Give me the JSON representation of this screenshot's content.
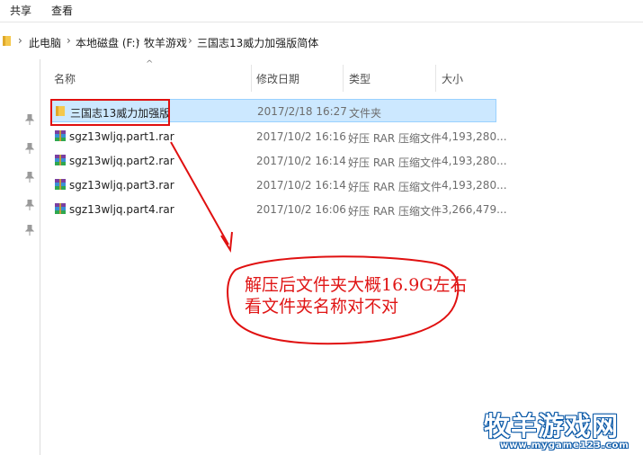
{
  "ribbon": {
    "tabs": [
      "共享",
      "查看"
    ]
  },
  "address": {
    "crumbs": [
      "此电脑",
      "本地磁盘 (F:)",
      "牧羊游戏",
      "三国志13威力加强版简体"
    ]
  },
  "columns": {
    "name": "名称",
    "date": "修改日期",
    "type": "类型",
    "size": "大小"
  },
  "files": [
    {
      "name": "三国志13威力加强版",
      "date": "2017/2/18 16:27",
      "type": "文件夹",
      "size": "",
      "icon": "folder-icon",
      "selected": true
    },
    {
      "name": "sgz13wljq.part1.rar",
      "date": "2017/10/2 16:16",
      "type": "好压 RAR 压缩文件",
      "size": "4,193,280...",
      "icon": "rar-archive-icon"
    },
    {
      "name": "sgz13wljq.part2.rar",
      "date": "2017/10/2 16:14",
      "type": "好压 RAR 压缩文件",
      "size": "4,193,280...",
      "icon": "rar-archive-icon"
    },
    {
      "name": "sgz13wljq.part3.rar",
      "date": "2017/10/2 16:14",
      "type": "好压 RAR 压缩文件",
      "size": "4,193,280...",
      "icon": "rar-archive-icon"
    },
    {
      "name": "sgz13wljq.part4.rar",
      "date": "2017/10/2 16:06",
      "type": "好压 RAR 压缩文件",
      "size": "3,266,479...",
      "icon": "rar-archive-icon"
    }
  ],
  "annotation": {
    "line1": "解压后文件夹大概16.9G左右",
    "line2": "看文件夹名称对不对",
    "color": "#e01616"
  },
  "watermark": {
    "title": "牧羊游戏网",
    "url": "www.mygame123.com"
  },
  "colors": {
    "selection": "#cce8ff",
    "highlight_box": "#e01010",
    "folder": "#f5c84c"
  }
}
